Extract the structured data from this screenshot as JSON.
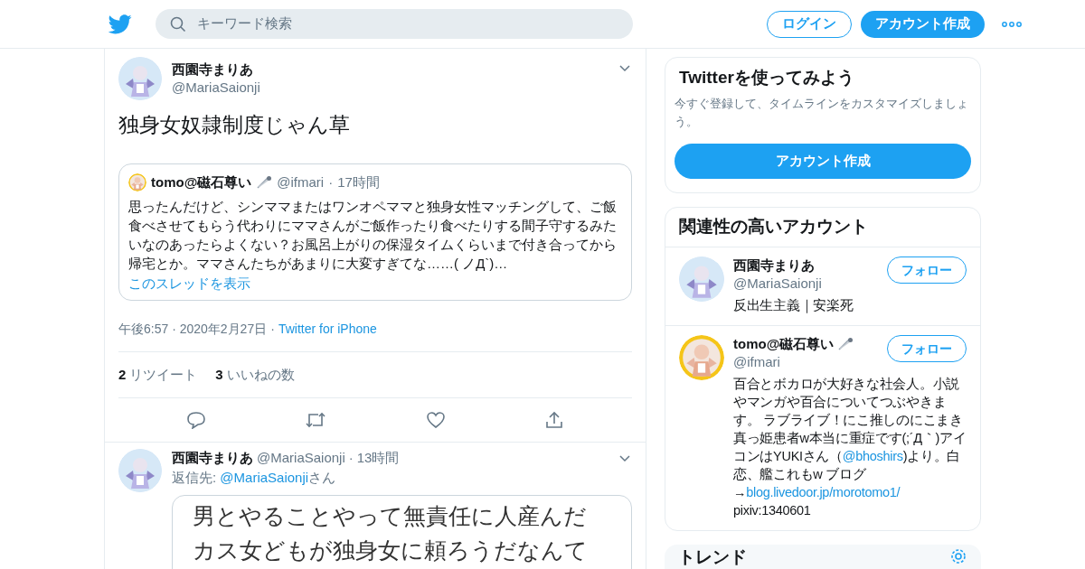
{
  "header": {
    "search": {
      "placeholder": "キーワード検索"
    },
    "login": "ログイン",
    "signup": "アカウント作成"
  },
  "tweet": {
    "name": "西園寺まりあ",
    "handle": "@MariaSaionji",
    "text": "独身女奴隷制度じゃん草",
    "quote": {
      "name": "tomo@磁石尊い",
      "handle": "@ifmari",
      "sep": "·",
      "time": "17時間",
      "text": "思ったんだけど、シンママまたはワンオペママと独身女性マッチングして、ご飯食べさせてもらう代わりにママさんがご飯作ったり食べたりする間子守するみたいなのあったらよくない？お風呂上がりの保湿タイムくらいまで付き合ってから帰宅とか。ママさんたちがあまりに大変すぎてな……( ノД`)…",
      "thread_link": "このスレッドを表示"
    },
    "time": "午後6:57 · 2020年2月27日",
    "sep": "·",
    "source": "Twitter for iPhone",
    "stats": [
      {
        "count": "2",
        "label": "リツイート"
      },
      {
        "count": "3",
        "label": "いいねの数"
      }
    ]
  },
  "reply": {
    "name": "西園寺まりあ",
    "handle": "@MariaSaionji",
    "sep": "·",
    "time": "13時間",
    "reply_prefix": "返信先: ",
    "reply_to": "@MariaSaionji",
    "reply_suffix": "さん",
    "image_lines": [
      "男とやることやって無責任に人産んだ",
      "カス女どもが独身女に頼ろうだなんて"
    ]
  },
  "signup_card": {
    "title": "Twitterを使ってみよう",
    "text": "今すぐ登録して、タイムラインをカスタマイズしましょう。",
    "button": "アカウント作成"
  },
  "related": {
    "title": "関連性の高いアカウント",
    "accounts": [
      {
        "name": "西園寺まりあ",
        "handle": "@MariaSaionji",
        "pin": false,
        "follow": "フォロー",
        "bio": [
          {
            "kind": "text",
            "text": "反出生主義｜安楽死"
          }
        ]
      },
      {
        "name": "tomo@磁石尊い",
        "handle": "@ifmari",
        "pin": true,
        "follow": "フォロー",
        "bio": [
          {
            "kind": "text",
            "text": "百合とボカロが大好きな社会人。小説やマンガや百合についてつぶやきます。 ラブライブ！にこ推しのにこまき真っ姫患者w本当に重症です(;´Д｀)アイコンはYUKIさん（"
          },
          {
            "kind": "link",
            "text": "@bhoshirs"
          },
          {
            "kind": "text",
            "text": ")より。白恋、艦これもw ブログ→"
          },
          {
            "kind": "link",
            "text": "blog.livedoor.jp/morotomo1/"
          },
          {
            "kind": "text",
            "text": " pixiv:1340601"
          }
        ]
      }
    ]
  },
  "trends": {
    "title": "トレンド"
  }
}
